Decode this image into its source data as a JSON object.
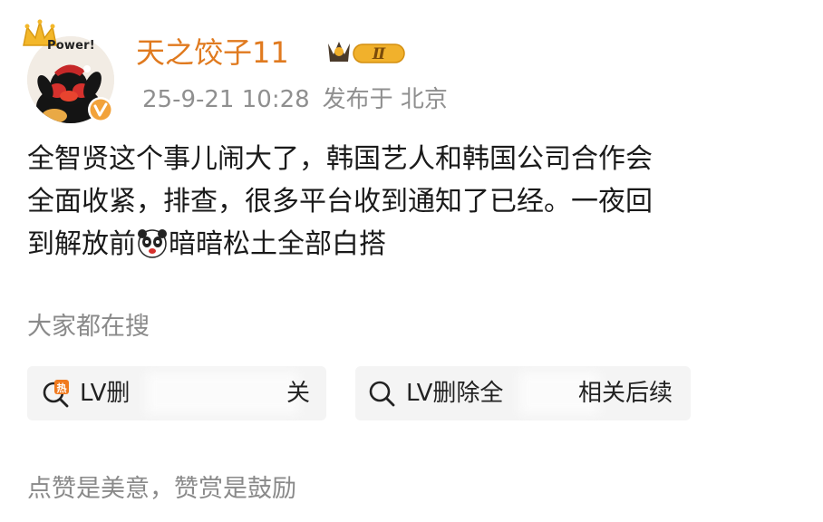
{
  "avatar": {
    "power_text": "Power!"
  },
  "user": {
    "name": "天之饺子11",
    "level_badge": "Ⅱ"
  },
  "post": {
    "date": "25-9-21 10:28",
    "published_at": "发布于 北京",
    "lines": [
      "全智贤这个事儿闹大了，韩国艺人和韩国公司合作会",
      "全面收紧，排查，很多平台收到通知了已经。一夜回"
    ],
    "line3_before_emoji": "到解放前",
    "line3_after_emoji": "暗暗松土全部白搭"
  },
  "trending": {
    "title": "大家都在搜",
    "chips": [
      {
        "icon": "hot-search-icon",
        "left_text": "LV删",
        "right_text": "关"
      },
      {
        "icon": "search-icon",
        "left_text": "LV删除全",
        "right_text": "相关后续"
      }
    ]
  },
  "footer": {
    "reward_text": "点赞是美意，赞赏是鼓励"
  },
  "colors": {
    "username": "#e07a1f",
    "meta": "#8f8f8f",
    "body": "#1a1a1a",
    "chip_bg": "#f4f4f4",
    "hot_icon": "#f07a1f"
  }
}
